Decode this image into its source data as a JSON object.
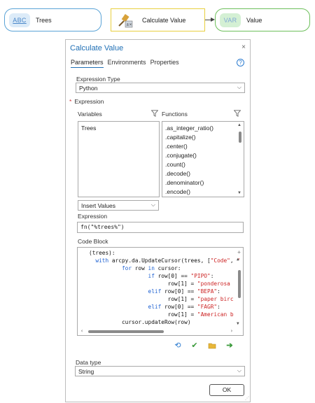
{
  "nodes": {
    "trees": {
      "icon_text": "ABC",
      "label": "Trees"
    },
    "calc": {
      "label": "Calculate Value"
    },
    "value": {
      "icon_text": "VAR",
      "label": "Value"
    }
  },
  "dialog": {
    "title": "Calculate Value",
    "close": "×",
    "tabs": [
      "Parameters",
      "Environments",
      "Properties"
    ],
    "active_tab": "Parameters",
    "help": "?",
    "expression_type": {
      "label": "Expression Type",
      "value": "Python"
    },
    "expression_section": {
      "required_marker": "*",
      "label": "Expression"
    },
    "variables": {
      "header": "Variables",
      "items": [
        "Trees"
      ]
    },
    "functions": {
      "header": "Functions",
      "items": [
        ".as_integer_ratio()",
        ".capitalize()",
        ".center()",
        ".conjugate()",
        ".count()",
        ".decode()",
        ".denominator()",
        ".encode()"
      ]
    },
    "insert_values": {
      "value": "Insert Values"
    },
    "expression": {
      "label": "Expression",
      "value": "fn(\"%trees%\")"
    },
    "code_block": {
      "label": "Code Block",
      "lines": [
        "(trees):",
        "  with arcpy.da.UpdateCursor(trees, [\"Code\", \"",
        "          for row in cursor:",
        "                  if row[0] == \"PIPO\":",
        "                        row[1] = \"ponderosa",
        "                  elif row[0] == \"BEPA\":",
        "                        row[1] = \"paper birc",
        "                  elif row[0] == \"FAGR\":",
        "                        row[1] = \"American b",
        "          cursor.updateRow(row)"
      ]
    },
    "data_type": {
      "label": "Data type",
      "value": "String"
    },
    "ok_label": "OK"
  },
  "colors": {
    "accent": "#1f6fb5",
    "trees_border": "#5aa3d6",
    "calc_border": "#e8cf3f",
    "value_border": "#6dbf5b",
    "required": "#d13438"
  }
}
